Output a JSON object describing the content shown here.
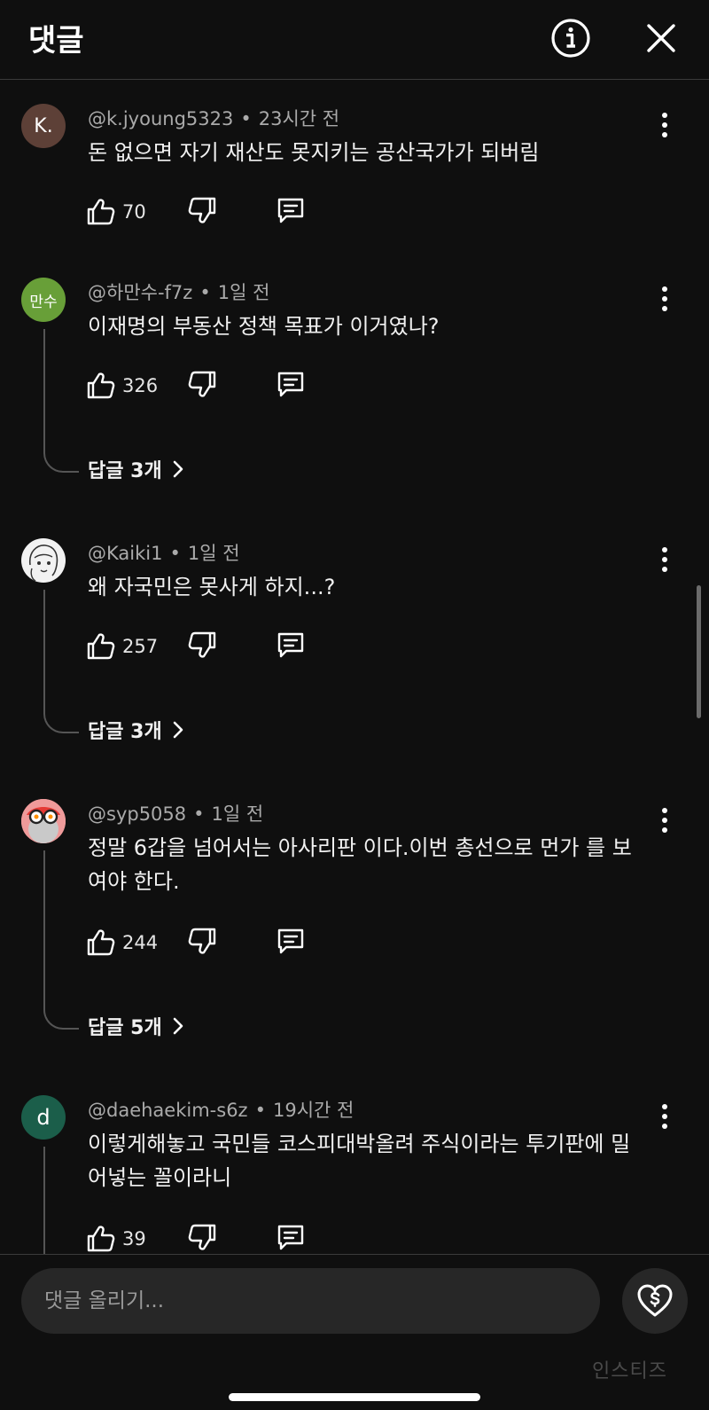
{
  "header": {
    "title": "댓글"
  },
  "comments": [
    {
      "avatar_text": "K.",
      "avatar_color": "#5d4037",
      "author": "@k.jyoung5323",
      "time": "23시간 전",
      "text": "돈 없으면 자기 재산도 못지키는 공산국가가 되버림",
      "likes": "70",
      "replies": ""
    },
    {
      "avatar_text": "만수",
      "avatar_color": "#689f38",
      "author": "@하만수-f7z",
      "time": "1일 전",
      "text": "이재명의 부동산 정책 목표가 이거였나?",
      "likes": "326",
      "replies": "답글 3개"
    },
    {
      "avatar_text": "",
      "avatar_color": "#f2f2f2",
      "avatar_icon": "cartoon-face-avatar",
      "author": "@Kaiki1",
      "time": "1일 전",
      "text": "왜 자국민은 못사게 하지...?",
      "likes": "257",
      "replies": "답글 3개"
    },
    {
      "avatar_text": "",
      "avatar_color": "#f4a3a3",
      "avatar_icon": "glasses-face-avatar",
      "author": "@syp5058",
      "time": "1일 전",
      "text": "정말 6갑을 넘어서는 아사리판 이다.이번 총선으로 먼가 를 보여야 한다.",
      "likes": "244",
      "replies": "답글 5개"
    },
    {
      "avatar_text": "d",
      "avatar_color": "#1b5e4a",
      "author": "@daehaekim-s6z",
      "time": "19시간 전",
      "text": "이렇게해놓고 국민들 코스피대박올려 주식이라는 투기판에 밀어넣는 꼴이라니",
      "likes": "39",
      "replies": ""
    }
  ],
  "composer": {
    "placeholder": "댓글 올리기..."
  },
  "watermark": "인스티즈",
  "icons": {
    "info": "info-icon",
    "close": "close-icon",
    "like": "thumbs-up-icon",
    "dislike": "thumbs-down-icon",
    "reply": "reply-icon",
    "more": "more-vertical-icon",
    "chevron": "chevron-right-icon",
    "thanks": "heart-dollar-icon"
  }
}
